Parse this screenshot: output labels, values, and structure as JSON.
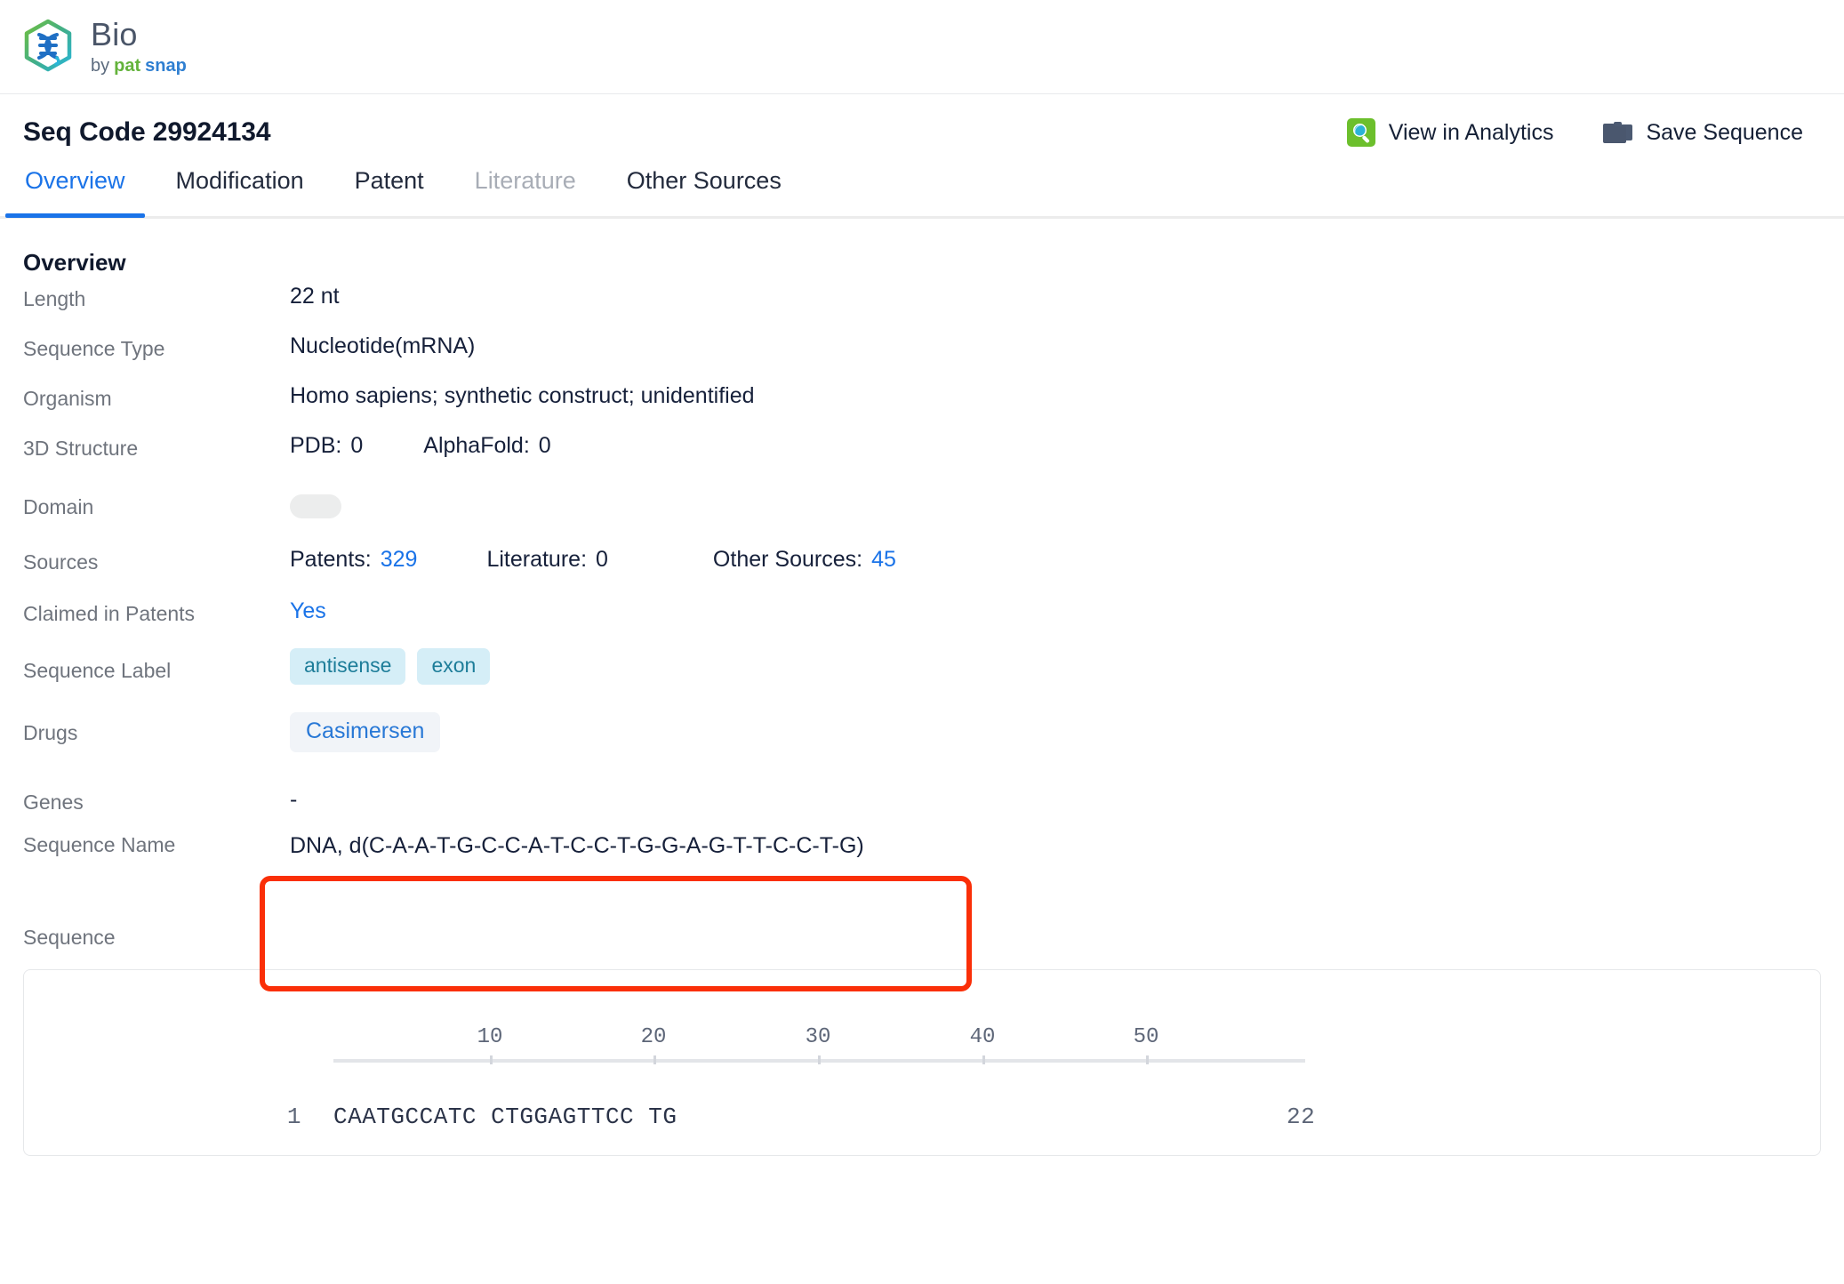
{
  "brand": {
    "name": "Bio",
    "by": "by",
    "pat": "pat",
    "snap": "snap",
    "logo_icon": "dna-hexagon-logo"
  },
  "header": {
    "title": "Seq Code 29924134",
    "actions": [
      {
        "label": "View in Analytics",
        "icon": "analytics-search-icon"
      },
      {
        "label": "Save Sequence",
        "icon": "folder-icon"
      }
    ]
  },
  "tabs": [
    {
      "label": "Overview",
      "state": "active"
    },
    {
      "label": "Modification",
      "state": "normal"
    },
    {
      "label": "Patent",
      "state": "normal"
    },
    {
      "label": "Literature",
      "state": "disabled"
    },
    {
      "label": "Other Sources",
      "state": "normal"
    }
  ],
  "overview": {
    "section_title": "Overview",
    "length": {
      "label": "Length",
      "value": "22 nt"
    },
    "sequence_type": {
      "label": "Sequence Type",
      "value": "Nucleotide(mRNA)"
    },
    "organism": {
      "label": "Organism",
      "value": "Homo sapiens; synthetic construct; unidentified"
    },
    "structure3d": {
      "label": "3D Structure",
      "pdb_label": "PDB:",
      "pdb_value": "0",
      "alphafold_label": "AlphaFold:",
      "alphafold_value": "0"
    },
    "domain": {
      "label": "Domain",
      "value": ""
    },
    "sources": {
      "label": "Sources",
      "patents_label": "Patents:",
      "patents_value": "329",
      "literature_label": "Literature:",
      "literature_value": "0",
      "other_label": "Other Sources:",
      "other_value": "45"
    },
    "claimed": {
      "label": "Claimed in Patents",
      "value": "Yes"
    },
    "sequence_label": {
      "label": "Sequence Label",
      "tags": [
        "antisense",
        "exon"
      ]
    },
    "drugs": {
      "label": "Drugs",
      "tags": [
        "Casimersen"
      ]
    },
    "genes": {
      "label": "Genes",
      "value": "-"
    },
    "sequence_name": {
      "label": "Sequence Name",
      "value": "DNA, d(C-A-A-T-G-C-C-A-T-C-C-T-G-G-A-G-T-T-C-C-T-G)"
    }
  },
  "sequence_panel": {
    "label": "Sequence",
    "start_index": "1",
    "end_index": "22",
    "bases": "CAATGCCATC CTGGAGTTCC TG",
    "ruler_ticks": [
      "10",
      "20",
      "30",
      "40",
      "50"
    ]
  },
  "colors": {
    "accent_blue": "#1a73e8",
    "tag_bg": "#d5eef7",
    "tag_text": "#1d7d99",
    "annotation_red": "#fa2f08",
    "brand_green": "#63b33b"
  }
}
